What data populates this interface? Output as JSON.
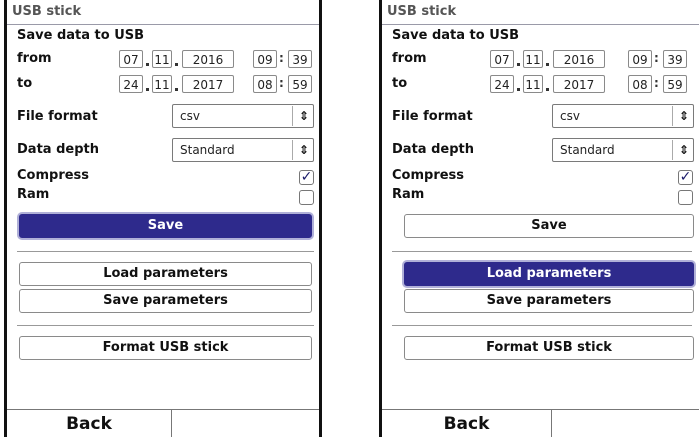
{
  "screens": [
    {
      "title": "USB stick",
      "section_label": "Save data to USB",
      "from_label": "from",
      "to_label": "to",
      "from": {
        "day": "07",
        "month": "11",
        "year": "2016",
        "hour": "09",
        "minute": "39"
      },
      "to": {
        "day": "24",
        "month": "11",
        "year": "2017",
        "hour": "08",
        "minute": "59"
      },
      "file_format_label": "File format",
      "file_format_value": "csv",
      "data_depth_label": "Data depth",
      "data_depth_value": "Standard",
      "compress_label": "Compress",
      "compress_checked": true,
      "ram_label": "Ram",
      "ram_checked": false,
      "save_label": "Save",
      "load_params_label": "Load parameters",
      "save_params_label": "Save parameters",
      "format_label": "Format USB stick",
      "back_label": "Back",
      "highlighted": "save"
    },
    {
      "title": "USB stick",
      "section_label": "Save data to USB",
      "from_label": "from",
      "to_label": "to",
      "from": {
        "day": "07",
        "month": "11",
        "year": "2016",
        "hour": "09",
        "minute": "39"
      },
      "to": {
        "day": "24",
        "month": "11",
        "year": "2017",
        "hour": "08",
        "minute": "59"
      },
      "file_format_label": "File format",
      "file_format_value": "csv",
      "data_depth_label": "Data depth",
      "data_depth_value": "Standard",
      "compress_label": "Compress",
      "compress_checked": true,
      "ram_label": "Ram",
      "ram_checked": false,
      "save_label": "Save",
      "load_params_label": "Load parameters",
      "save_params_label": "Save parameters",
      "format_label": "Format USB stick",
      "back_label": "Back",
      "highlighted": "load_parameters"
    }
  ],
  "colors": {
    "accent": "#2e2a8c",
    "title_text": "#555555"
  },
  "icons": {
    "select_arrow": "updown-arrow-icon",
    "checkbox": "checkmark-icon"
  }
}
